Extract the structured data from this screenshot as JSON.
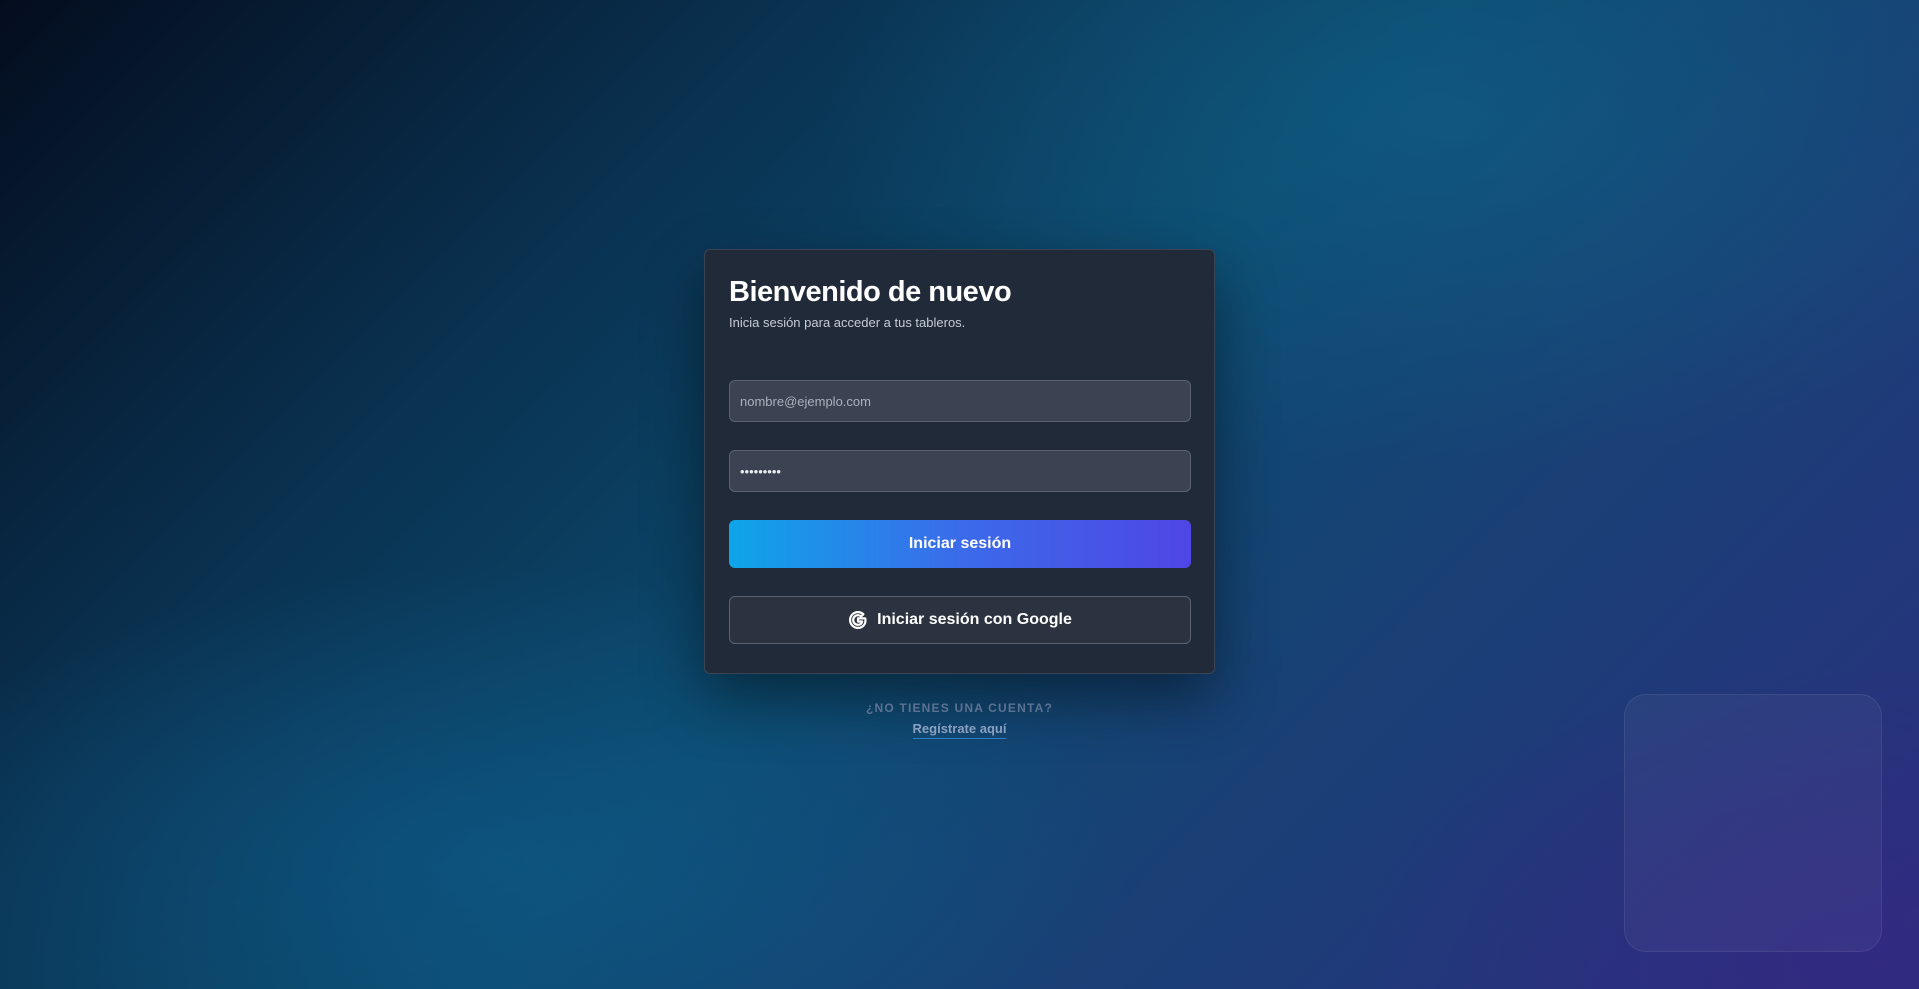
{
  "login": {
    "title": "Bienvenido de nuevo",
    "subtitle": "Inicia sesión para acceder a tus tableros.",
    "email_placeholder": "nombre@ejemplo.com",
    "email_value": "",
    "password_value": "123456789",
    "submit_label": "Iniciar sesión",
    "google_label": "Iniciar sesión con Google",
    "google_icon": "google-icon"
  },
  "signup": {
    "question": "¿NO TIENES UNA CUENTA?",
    "link_label": "Regístrate aquí"
  },
  "colors": {
    "card_background": "#212a39",
    "primary_gradient_start": "#0ea5e9",
    "primary_gradient_end": "#4f46e5",
    "field_background": "#3b4352",
    "link_underline": "#2b7fc4"
  }
}
